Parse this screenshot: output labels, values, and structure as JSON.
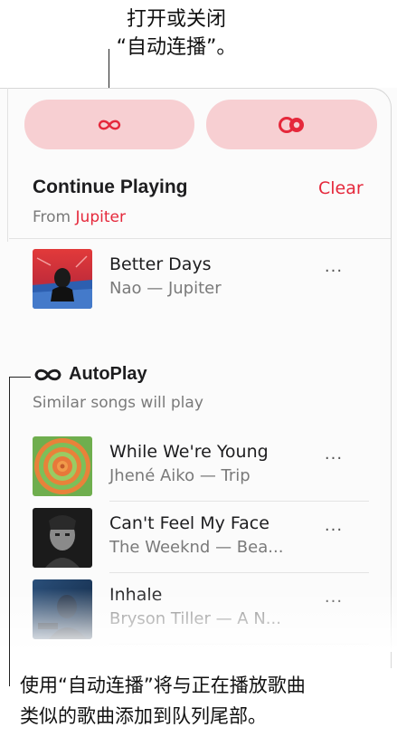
{
  "callouts": {
    "top_line1": "打开或关闭",
    "top_line2": "“自动连播”。",
    "bottom_line1": "使用“自动连播”将与正在播放歌曲",
    "bottom_line2": "类似的歌曲添加到队列尾部。"
  },
  "toolbar": {
    "autoplay_icon": "infinity-icon",
    "repeat_icon": "repeat-toggle-icon"
  },
  "continue_playing": {
    "title": "Continue Playing",
    "clear_label": "Clear",
    "from_prefix": "From",
    "from_source": "Jupiter"
  },
  "queue": [
    {
      "title": "Better Days",
      "subtitle": "Nao — Jupiter",
      "more": "···"
    }
  ],
  "autoplay": {
    "title": "AutoPlay",
    "subtitle": "Similar songs will play",
    "items": [
      {
        "title": "While We're Young",
        "subtitle": "Jhené Aiko — Trip",
        "more": "···"
      },
      {
        "title": "Can't Feel My Face",
        "subtitle": "The Weeknd — Bea...",
        "more": "···"
      },
      {
        "title": "Inhale",
        "subtitle": "Bryson Tiller — A N...",
        "more": "···"
      }
    ]
  },
  "colors": {
    "accent": "#e5283b",
    "pill_background": "#f7cfd2",
    "secondary_text": "#7a7a7a"
  }
}
